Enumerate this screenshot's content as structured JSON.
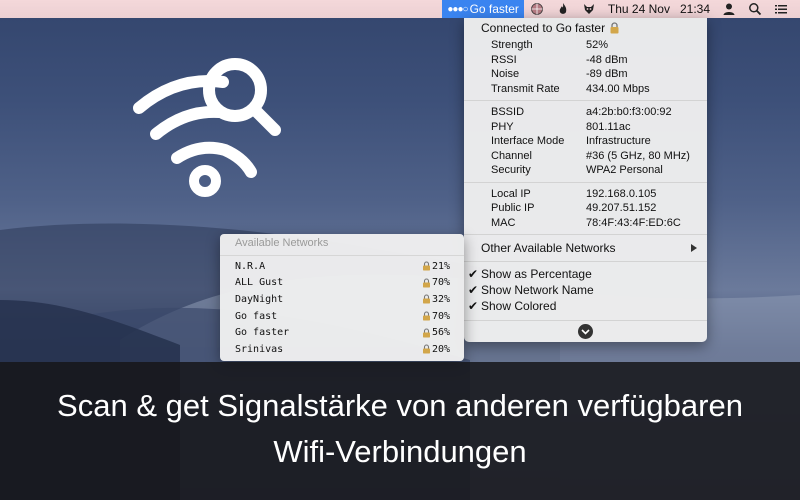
{
  "menubar": {
    "app_label": "Go faster",
    "date": "Thu 24 Nov",
    "time": "21:34",
    "icons": [
      "wifi-dots-icon",
      "globe-icon",
      "flame-icon",
      "fox-icon",
      "user-icon",
      "search-icon",
      "list-icon"
    ]
  },
  "wifi_menu": {
    "connected_label": "Connected to Go faster",
    "group1": [
      {
        "key": "Strength",
        "value": "52%"
      },
      {
        "key": "RSSI",
        "value": "-48 dBm"
      },
      {
        "key": "Noise",
        "value": "-89 dBm"
      },
      {
        "key": "Transmit Rate",
        "value": "434.00 Mbps"
      }
    ],
    "group2": [
      {
        "key": "BSSID",
        "value": "a4:2b:b0:f3:00:92"
      },
      {
        "key": "PHY",
        "value": "801.11ac"
      },
      {
        "key": "Interface Mode",
        "value": "Infrastructure"
      },
      {
        "key": "Channel",
        "value": "#36 (5 GHz, 80 MHz)"
      },
      {
        "key": "Security",
        "value": "WPA2 Personal"
      }
    ],
    "group3": [
      {
        "key": "Local IP",
        "value": "192.168.0.105"
      },
      {
        "key": "Public IP",
        "value": "49.207.51.152"
      },
      {
        "key": "MAC",
        "value": "78:4F:43:4F:ED:6C"
      }
    ],
    "other_networks_label": "Other Available Networks",
    "options": [
      {
        "label": "Show as Percentage",
        "checked": true
      },
      {
        "label": "Show Network Name",
        "checked": true
      },
      {
        "label": "Show Colored",
        "checked": true
      }
    ]
  },
  "networks_panel": {
    "title": "Available Networks",
    "networks": [
      {
        "name": "N.R.A",
        "strength": "21%"
      },
      {
        "name": "ALL Gust",
        "strength": "70%"
      },
      {
        "name": "DayNight",
        "strength": "32%"
      },
      {
        "name": "Go fast",
        "strength": "70%"
      },
      {
        "name": "Go faster",
        "strength": "56%"
      },
      {
        "name": "Srinivas",
        "strength": "20%"
      }
    ]
  },
  "caption": {
    "line1": "Scan & get Signalstärke von anderen verfügbaren",
    "line2": "Wifi-Verbindungen"
  },
  "colors": {
    "accent": "#3a84f0",
    "menubar": "#f0d4d6",
    "caption_bar": "#16161a"
  }
}
